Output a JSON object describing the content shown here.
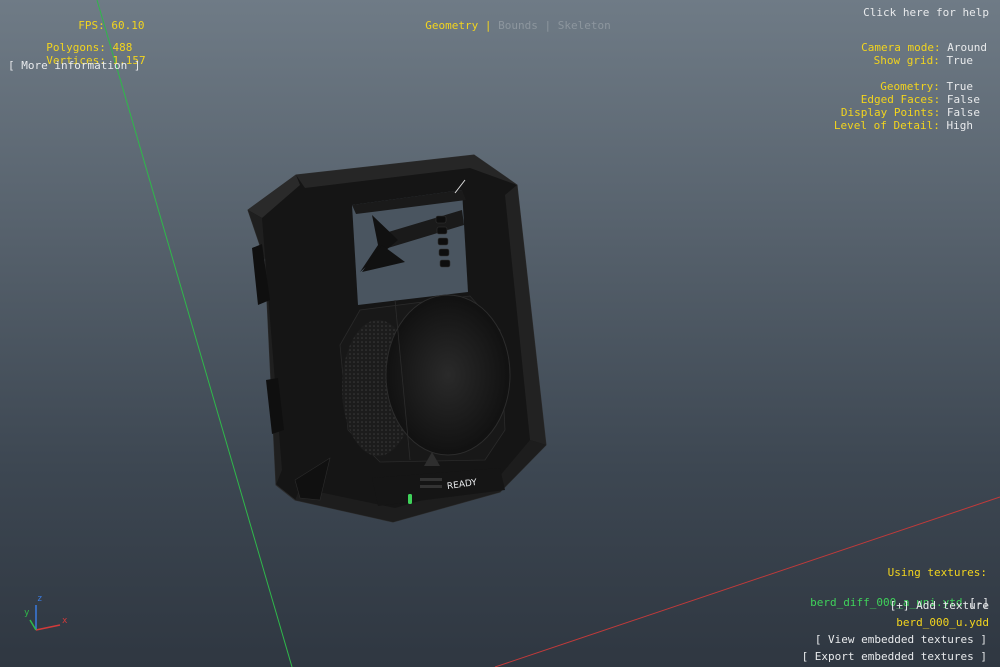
{
  "stats": {
    "fps_label": "FPS:",
    "fps_value": "60.10",
    "polygons_label": "Polygons:",
    "polygons_value": "488",
    "vertices_label": "Vertices:",
    "vertices_value": "1,157",
    "more_info": "[ More information ]"
  },
  "tabs": {
    "geometry": "Geometry",
    "bounds": "Bounds",
    "skeleton": "Skeleton",
    "separator": "|"
  },
  "help": "Click here for help",
  "settings": {
    "camera_mode_label": "Camera mode:",
    "camera_mode_value": "Around",
    "show_grid_label": "Show grid:",
    "show_grid_value": "True",
    "geometry_label": "Geometry:",
    "geometry_value": "True",
    "edged_faces_label": "Edged Faces:",
    "edged_faces_value": "False",
    "display_points_label": "Display Points:",
    "display_points_value": "False",
    "lod_label": "Level of Detail:",
    "lod_value": "High"
  },
  "textures": {
    "heading": "Using textures:",
    "texture_file": "berd_diff_000_a_uni.ytd",
    "remove": "[-]",
    "add": "[+] Add texture",
    "model_file": "berd_000_u.ydd",
    "view_embedded": "[ View embedded textures ]",
    "export_embedded": "[ Export embedded textures ]"
  },
  "model": {
    "ready_label": "READY"
  },
  "axes": {
    "x": "x",
    "y": "y",
    "z": "z"
  },
  "colors": {
    "hud_yellow": "#f2d41e",
    "hud_white": "#e8eaec",
    "hud_green": "#3fd25a",
    "grid_green": "#2fb84a",
    "grid_red": "#c23a3a"
  }
}
